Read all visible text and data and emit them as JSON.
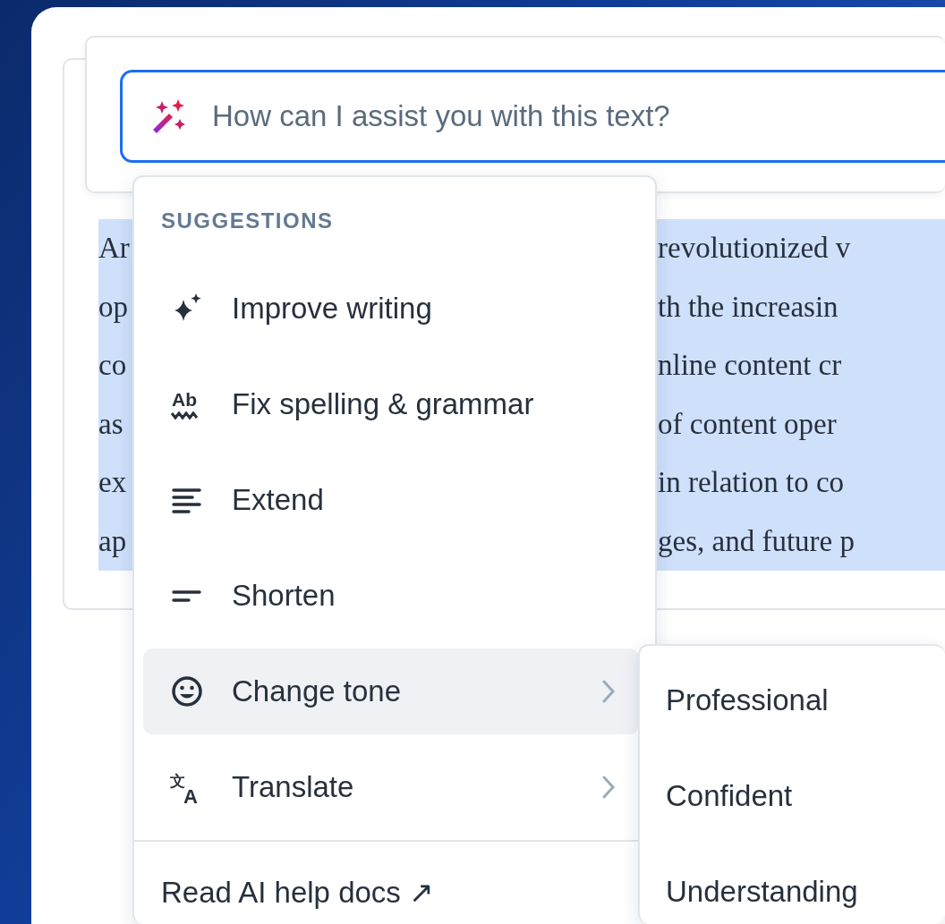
{
  "prompt": {
    "placeholder": "How can I assist you with this text?"
  },
  "document": {
    "lines": [
      {
        "left": "Ar",
        "right": "revolutionized v"
      },
      {
        "left": "op",
        "right": "th the increasin"
      },
      {
        "left": "co",
        "right": "nline content cr"
      },
      {
        "left": "as",
        "right": "of content oper"
      },
      {
        "left": "ex",
        "right": "in relation to co"
      },
      {
        "left": "ap",
        "right": "ges, and future p"
      }
    ]
  },
  "menu": {
    "heading": "SUGGESTIONS",
    "items": [
      {
        "label": "Improve writing",
        "has_submenu": false,
        "selected": false
      },
      {
        "label": "Fix spelling & grammar",
        "icon_text": [
          "Ab"
        ],
        "has_submenu": false,
        "selected": false
      },
      {
        "label": "Extend",
        "has_submenu": false,
        "selected": false
      },
      {
        "label": "Shorten",
        "has_submenu": false,
        "selected": false
      },
      {
        "label": "Change tone",
        "has_submenu": true,
        "selected": true
      },
      {
        "label": "Translate",
        "icon_text": [
          "文",
          "A"
        ],
        "has_submenu": true,
        "selected": false
      }
    ],
    "footer_link": "Read AI help docs ↗"
  },
  "submenu": {
    "items": [
      {
        "label": "Professional"
      },
      {
        "label": "Confident"
      },
      {
        "label": "Understanding"
      }
    ]
  }
}
